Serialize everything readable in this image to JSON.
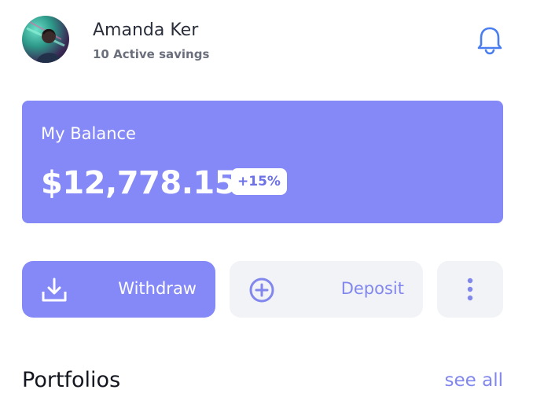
{
  "user": {
    "name": "Amanda Ker",
    "subtitle": "10 Active savings",
    "avatar_icon": "avatar-photo"
  },
  "header": {
    "notification_icon": "bell-icon",
    "accent_color": "#4a7ef0"
  },
  "balance": {
    "label": "My Balance",
    "amount": "$12,778.15",
    "change": "+15%",
    "card_color": "#8489f7"
  },
  "actions": {
    "withdraw": {
      "label": "Withdraw",
      "icon": "download-tray-icon"
    },
    "deposit": {
      "label": "Deposit",
      "icon": "plus-circle-icon"
    },
    "more": {
      "icon": "more-vertical-icon"
    }
  },
  "portfolios": {
    "title": "Portfolios",
    "see_all_label": "see all"
  }
}
